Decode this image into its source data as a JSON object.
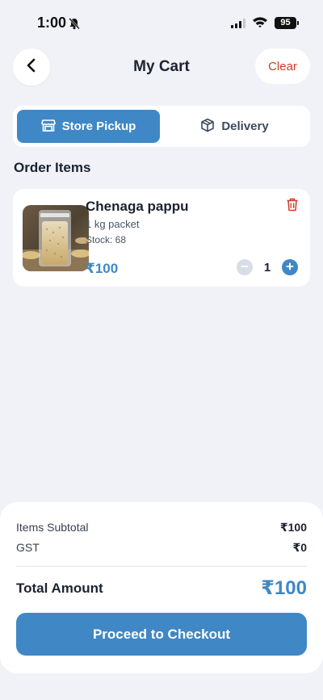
{
  "status_bar": {
    "time": "1:00",
    "battery": "95"
  },
  "header": {
    "title": "My Cart",
    "clear_label": "Clear"
  },
  "fulfillment": {
    "tabs": [
      {
        "label": "Store Pickup",
        "icon": "store-icon",
        "selected": true
      },
      {
        "label": "Delivery",
        "icon": "box-icon",
        "selected": false
      }
    ]
  },
  "order_items": {
    "title": "Order Items",
    "items": [
      {
        "name": "Chenaga pappu",
        "size": "1 kg packet",
        "stock": "Stock: 68",
        "price": "₹100",
        "quantity": "1"
      }
    ]
  },
  "summary": {
    "subtotal_label": "Items Subtotal",
    "subtotal_value": "₹100",
    "gst_label": "GST",
    "gst_value": "₹0",
    "total_label": "Total Amount",
    "total_value": "₹100",
    "checkout_label": "Proceed to Checkout"
  },
  "colors": {
    "accent": "#3f88c5",
    "danger": "#d13b2a",
    "background": "#f1f2f7"
  }
}
